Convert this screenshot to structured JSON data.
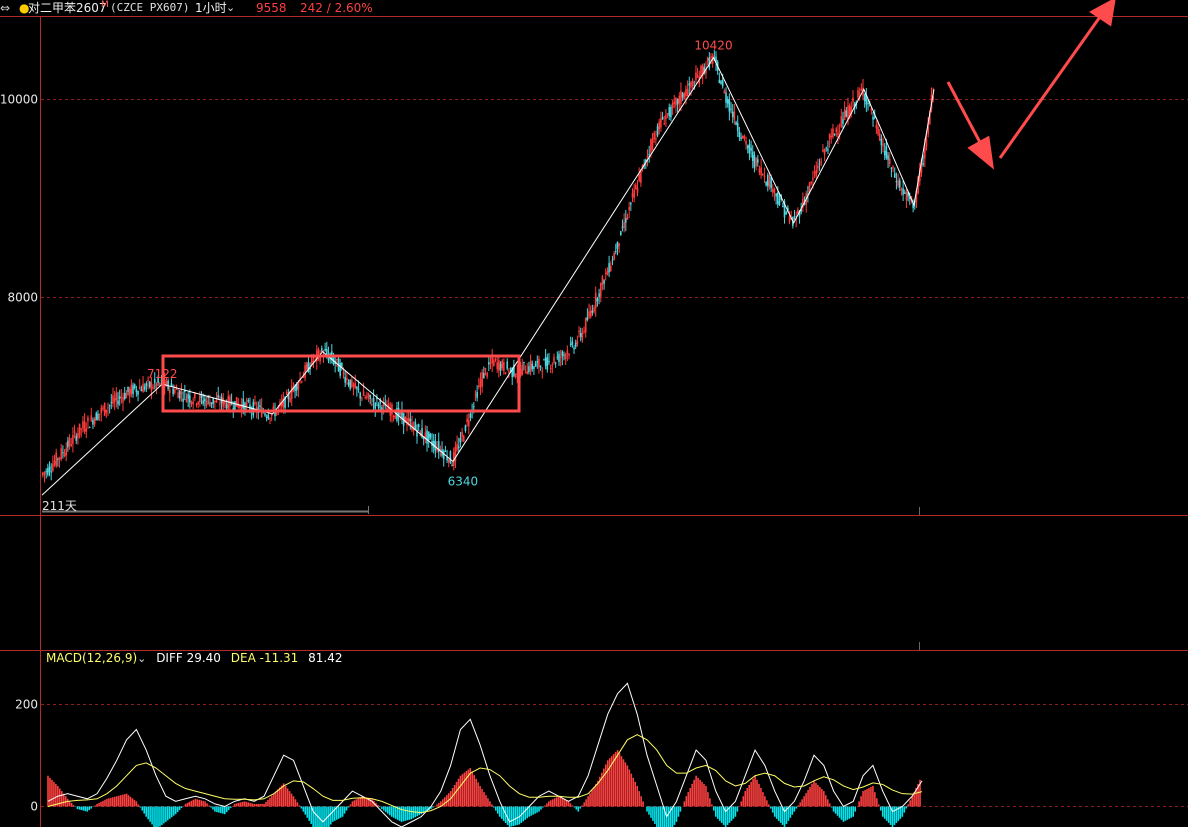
{
  "header": {
    "menu_icon": "equals-icon",
    "dot_color": "#ffcc00",
    "instrument_name": "对二甲苯2607",
    "instrument_suffix": "M",
    "code": "(CZCE PX607)",
    "period": "1小时",
    "period_chevron": "chevron-down-icon",
    "last_price": "9558",
    "change": "242 / 2.60%",
    "up_color": "#ff4040"
  },
  "main_panel": {
    "y_ticks": [
      "10000",
      "8000"
    ],
    "high_label": "10420",
    "left_high_label": "7122",
    "low_label": "6340",
    "days_label": "211天",
    "annotation_box_color": "#ff4b4b",
    "arrow_color": "#ff4b4b",
    "up_candle_color": "#ff3b3b",
    "down_candle_color": "#4fd6e0",
    "zigzag_color": "#ffffff"
  },
  "indicator_panel": {
    "macd_title": "MACD(12,26,9)",
    "chevron": "chevron-down-icon",
    "diff_label": "DIFF 29.40",
    "dea_label": "DEA -11.31",
    "macd_value": "81.42",
    "y_ticks": [
      "200",
      "0"
    ],
    "pos_bar_color": "#ff4040",
    "neg_bar_color": "#00e5ee",
    "diff_color": "#ffffff",
    "dea_color": "#ffff66"
  },
  "chart_data": {
    "type": "line",
    "title": "对二甲苯2607 (CZCE PX607) 1小时",
    "ylim": [
      5900,
      10800
    ],
    "zigzag_points": [
      {
        "i": 0,
        "y": 6000
      },
      {
        "i": 12,
        "y": 7122
      },
      {
        "i": 23,
        "y": 6820
      },
      {
        "i": 28,
        "y": 7450
      },
      {
        "i": 41,
        "y": 6340
      },
      {
        "i": 67,
        "y": 10420
      },
      {
        "i": 75,
        "y": 8750
      },
      {
        "i": 82,
        "y": 10100
      },
      {
        "i": 87,
        "y": 8930
      },
      {
        "i": 89,
        "y": 10100
      }
    ],
    "price_series": [
      6200,
      6300,
      6420,
      6550,
      6680,
      6760,
      6850,
      6930,
      7000,
      7060,
      7090,
      7110,
      7122,
      7080,
      7020,
      6980,
      6960,
      6950,
      6940,
      6930,
      6910,
      6880,
      6850,
      6820,
      6900,
      7050,
      7200,
      7350,
      7450,
      7380,
      7250,
      7100,
      7000,
      6950,
      6900,
      6850,
      6780,
      6700,
      6620,
      6530,
      6450,
      6340,
      6600,
      6900,
      7200,
      7350,
      7300,
      7250,
      7280,
      7300,
      7320,
      7350,
      7420,
      7500,
      7650,
      7900,
      8150,
      8400,
      8700,
      9000,
      9300,
      9600,
      9800,
      9900,
      10050,
      10150,
      10300,
      10420,
      10100,
      9850,
      9600,
      9400,
      9250,
      9100,
      8900,
      8750,
      8950,
      9200,
      9450,
      9650,
      9800,
      9950,
      10100,
      9800,
      9500,
      9250,
      9050,
      8930,
      9400,
      10100
    ],
    "macd_ylim": [
      -40,
      270
    ],
    "macd_hist": [
      60,
      40,
      15,
      -5,
      -10,
      5,
      15,
      20,
      25,
      10,
      -20,
      -45,
      -30,
      -15,
      5,
      15,
      10,
      -10,
      -15,
      5,
      10,
      5,
      5,
      25,
      45,
      20,
      -10,
      -40,
      -55,
      -30,
      -20,
      10,
      20,
      15,
      -5,
      -20,
      -30,
      -25,
      -15,
      -5,
      10,
      30,
      60,
      75,
      40,
      10,
      -20,
      -40,
      -35,
      -20,
      -10,
      10,
      20,
      10,
      -10,
      20,
      50,
      90,
      110,
      80,
      40,
      -10,
      -40,
      -60,
      -30,
      20,
      60,
      40,
      -20,
      -40,
      -20,
      30,
      60,
      20,
      -20,
      -40,
      -10,
      20,
      50,
      30,
      -10,
      -30,
      -20,
      30,
      40,
      -20,
      -40,
      -20,
      20,
      60
    ],
    "macd_diff": [
      10,
      20,
      25,
      20,
      15,
      25,
      55,
      90,
      130,
      150,
      110,
      60,
      20,
      10,
      15,
      20,
      15,
      5,
      0,
      10,
      15,
      10,
      20,
      60,
      100,
      90,
      40,
      -10,
      -30,
      -10,
      10,
      30,
      20,
      10,
      -10,
      -30,
      -40,
      -30,
      -20,
      0,
      30,
      80,
      150,
      170,
      120,
      60,
      10,
      -30,
      -20,
      0,
      20,
      30,
      20,
      10,
      20,
      60,
      120,
      180,
      220,
      240,
      180,
      100,
      40,
      -20,
      10,
      60,
      110,
      90,
      30,
      -10,
      10,
      60,
      110,
      80,
      30,
      -10,
      10,
      50,
      100,
      80,
      30,
      0,
      10,
      60,
      80,
      30,
      -10,
      0,
      20,
      50
    ],
    "macd_dea": [
      0,
      5,
      10,
      12,
      13,
      15,
      25,
      40,
      60,
      80,
      85,
      75,
      60,
      45,
      35,
      30,
      25,
      20,
      15,
      14,
      14,
      13,
      15,
      25,
      40,
      50,
      48,
      35,
      20,
      12,
      12,
      16,
      17,
      15,
      10,
      2,
      -6,
      -10,
      -12,
      -8,
      0,
      15,
      40,
      65,
      75,
      72,
      60,
      40,
      25,
      18,
      18,
      20,
      20,
      18,
      18,
      25,
      45,
      70,
      100,
      130,
      140,
      130,
      110,
      80,
      65,
      65,
      75,
      80,
      70,
      50,
      40,
      45,
      60,
      65,
      60,
      45,
      38,
      40,
      50,
      58,
      52,
      40,
      33,
      38,
      46,
      43,
      32,
      25,
      24,
      29
    ]
  }
}
